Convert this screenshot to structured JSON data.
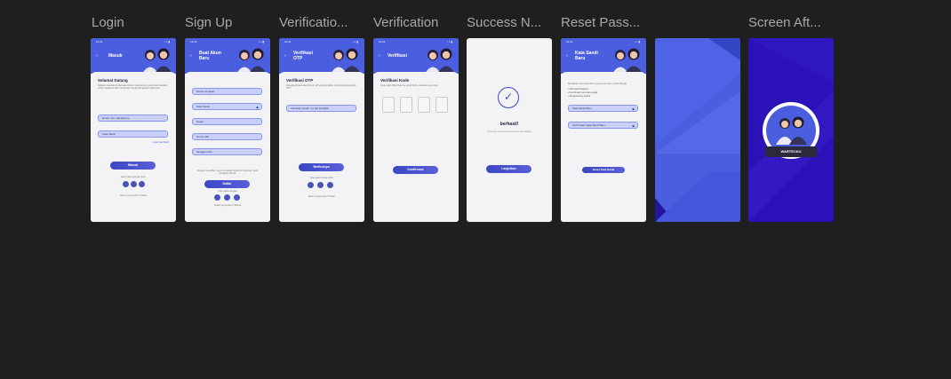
{
  "frames": {
    "login": "Login",
    "signup": "Sign Up",
    "verif_otp": "Verificatio...",
    "verif": "Verification",
    "success": "Success N...",
    "reset": "Reset Pass...",
    "after": "Screen Aft..."
  },
  "status": {
    "time": "12:41",
    "signal": "▪▪▮"
  },
  "login": {
    "back": "‹",
    "title": "Masuk",
    "heading": "Selamat Datang",
    "desc": "Silakan masukan Email atau Nomor Handphone yang telah terdaftar untuk masuk ke akun anda dan menikmati layanan Wartecku",
    "field_email": "Email / No. Handphone",
    "field_pass": "Kata Sandi",
    "forgot": "Lupa Kata Sandi",
    "btn": "Masuk",
    "or": "Atau masuk dengan akun",
    "register": "Belum punya akun? Daftar"
  },
  "signup": {
    "back": "‹",
    "title": "Buat Akun Baru",
    "fields": [
      "Nama Lengkap",
      "Kata Sandi",
      "Email",
      "Nomor HP",
      "Tanggal Lahir"
    ],
    "terms": "Dengan mendaftar, saya menyetujui Syarat & Ketentuan serta Kebijakan Privasi",
    "btn": "Daftar",
    "or": "Atau daftar dengan",
    "login": "Sudah punya akun? Masuk"
  },
  "otp": {
    "back": "‹",
    "title": "Verifikasi OTP",
    "heading": "Verifikasi OTP",
    "desc": "Masukan Email atau Nomor HP yang terdaftar untuk menerima kode OTP",
    "field": "masukan email / no HP terdaftar",
    "btn": "Berikutnya",
    "or": "Atau login dengan akun",
    "register": "Belum punya akun? Daftar"
  },
  "verif": {
    "back": "‹",
    "title": "Verifikasi",
    "heading": "Verifikasi Kode",
    "desc": "Kode telah dikirimkan ke email Anda, silahkan cek email",
    "btn": "Konfirmasi"
  },
  "success": {
    "heading": "berhasil!",
    "desc": "Selamat! Anda telah berhasil diverifikasi",
    "btn": "Lanjutkan"
  },
  "reset": {
    "back": "‹",
    "title": "Kata Sandi Baru",
    "desc": "Masukkan kata sandi baru yang aman dan mudah diingat",
    "bullets": [
      "• Minimal 8 karakter",
      "• Kombinasi huruf dan angka",
      "• Mengandung simbol"
    ],
    "field_new": "Kata Sandi Baru",
    "field_confirm": "Konfirmasi Kata Sandi Baru",
    "btn": "Reset Kata Sandi"
  },
  "after": {
    "logo": "WARTECKU"
  },
  "colors": {
    "accent": "#4b5ee0",
    "dark_purple": "#2b12b8",
    "bg": "#1f1f1f"
  }
}
